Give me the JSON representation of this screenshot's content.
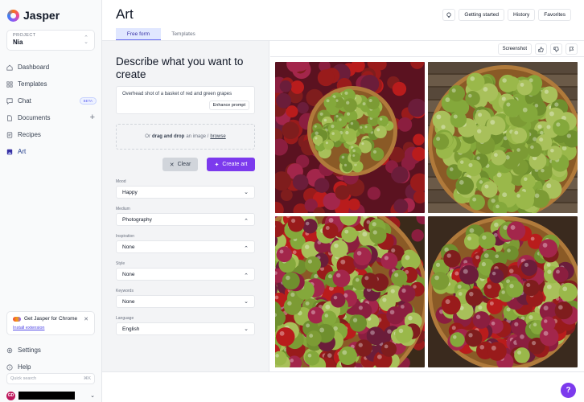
{
  "app": {
    "name": "Jasper"
  },
  "project": {
    "label": "PROJECT",
    "name": "Nia"
  },
  "sidebar": {
    "items": [
      {
        "label": "Dashboard",
        "icon": "home-icon"
      },
      {
        "label": "Templates",
        "icon": "grid-icon"
      },
      {
        "label": "Chat",
        "icon": "chat-icon",
        "badge": "BETA"
      },
      {
        "label": "Documents",
        "icon": "document-icon"
      },
      {
        "label": "Recipes",
        "icon": "recipe-icon"
      },
      {
        "label": "Art",
        "icon": "art-icon",
        "active": true
      }
    ],
    "chrome_card": {
      "title": "Get Jasper for Chrome",
      "link": "Install extension"
    },
    "bottom_items": [
      {
        "label": "Settings",
        "icon": "gear-icon"
      },
      {
        "label": "Help",
        "icon": "help-icon"
      }
    ],
    "quick_search": {
      "placeholder": "Quick search",
      "shortcut": "⌘K"
    },
    "user": {
      "initials": "GD"
    }
  },
  "header": {
    "title": "Art",
    "buttons": [
      "Getting started",
      "History",
      "Favorites"
    ],
    "tabs": [
      {
        "label": "Free form",
        "active": true
      },
      {
        "label": "Templates",
        "active": false
      }
    ]
  },
  "form": {
    "heading": "Describe what you want to create",
    "prompt": "Overhead shot of a basket of red and green grapes",
    "enhance_label": "Enhance prompt",
    "drop": {
      "prefix": "Or",
      "bold": "drag and drop",
      "middle": "an image /",
      "link": "browse"
    },
    "clear_label": "Clear",
    "create_label": "Create art",
    "fields": [
      {
        "label": "Mood",
        "value": "Happy",
        "chevron": "down"
      },
      {
        "label": "Medium",
        "value": "Photography",
        "chevron": "up"
      },
      {
        "label": "Inspiration",
        "value": "None",
        "chevron": "up"
      },
      {
        "label": "Style",
        "value": "None",
        "chevron": "up"
      },
      {
        "label": "Keywords",
        "value": "None",
        "chevron": "down"
      },
      {
        "label": "Language",
        "value": "English",
        "chevron": "down"
      }
    ]
  },
  "results": {
    "screenshot_label": "Screenshot",
    "images": [
      {
        "name": "grapes-image-1"
      },
      {
        "name": "grapes-image-2"
      },
      {
        "name": "grapes-image-3"
      },
      {
        "name": "grapes-image-4"
      }
    ]
  },
  "help_button": "?",
  "colors": {
    "accent": "#7c3aed",
    "active_tab": "#e0e7ff"
  }
}
